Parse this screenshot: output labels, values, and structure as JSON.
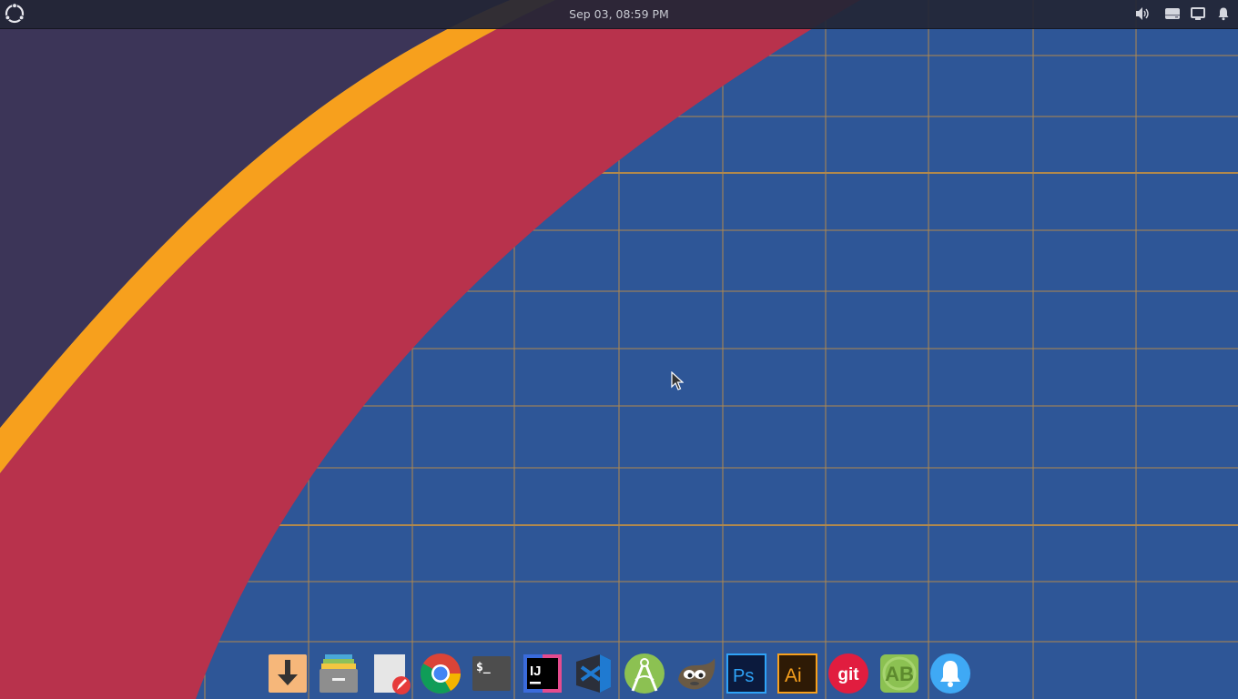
{
  "topbar": {
    "clock": "Sep 03, 08:59 PM",
    "menu_icon": "ubuntu-logo-icon",
    "tray": [
      {
        "name": "volume-icon"
      },
      {
        "name": "drive-icon"
      },
      {
        "name": "display-icon"
      },
      {
        "name": "notifications-bell-icon"
      }
    ]
  },
  "colors": {
    "wallpaper_blue": "#2e5697",
    "grid_line": "#c99140",
    "purple": "#3c3558",
    "orange": "#f7a01d",
    "red": "#b8324c"
  },
  "dock": {
    "items": [
      {
        "name": "downloads",
        "icon": "download-arrow-icon"
      },
      {
        "name": "files",
        "icon": "file-manager-icon"
      },
      {
        "name": "text-editor",
        "icon": "text-editor-icon"
      },
      {
        "name": "chrome",
        "icon": "chrome-icon"
      },
      {
        "name": "terminal",
        "icon": "terminal-icon",
        "label": "$_"
      },
      {
        "name": "intellij",
        "icon": "intellij-icon",
        "label": "IJ"
      },
      {
        "name": "vscode",
        "icon": "vscode-icon"
      },
      {
        "name": "android-studio",
        "icon": "android-studio-icon"
      },
      {
        "name": "gimp",
        "icon": "gimp-icon"
      },
      {
        "name": "photoshop",
        "icon": "photoshop-icon",
        "label": "Ps"
      },
      {
        "name": "illustrator",
        "icon": "illustrator-icon",
        "label": "Ai"
      },
      {
        "name": "git",
        "icon": "git-icon",
        "label": "git"
      },
      {
        "name": "appbuilder",
        "icon": "ab-icon",
        "label": "AB"
      },
      {
        "name": "notifications",
        "icon": "bell-icon"
      }
    ]
  }
}
